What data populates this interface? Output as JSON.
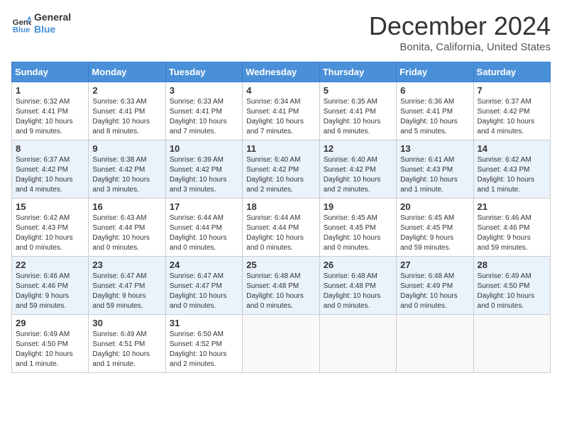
{
  "header": {
    "logo_line1": "General",
    "logo_line2": "Blue",
    "title": "December 2024",
    "subtitle": "Bonita, California, United States"
  },
  "days_of_week": [
    "Sunday",
    "Monday",
    "Tuesday",
    "Wednesday",
    "Thursday",
    "Friday",
    "Saturday"
  ],
  "weeks": [
    [
      {
        "day": "1",
        "info": "Sunrise: 6:32 AM\nSunset: 4:41 PM\nDaylight: 10 hours\nand 9 minutes."
      },
      {
        "day": "2",
        "info": "Sunrise: 6:33 AM\nSunset: 4:41 PM\nDaylight: 10 hours\nand 8 minutes."
      },
      {
        "day": "3",
        "info": "Sunrise: 6:33 AM\nSunset: 4:41 PM\nDaylight: 10 hours\nand 7 minutes."
      },
      {
        "day": "4",
        "info": "Sunrise: 6:34 AM\nSunset: 4:41 PM\nDaylight: 10 hours\nand 7 minutes."
      },
      {
        "day": "5",
        "info": "Sunrise: 6:35 AM\nSunset: 4:41 PM\nDaylight: 10 hours\nand 6 minutes."
      },
      {
        "day": "6",
        "info": "Sunrise: 6:36 AM\nSunset: 4:41 PM\nDaylight: 10 hours\nand 5 minutes."
      },
      {
        "day": "7",
        "info": "Sunrise: 6:37 AM\nSunset: 4:42 PM\nDaylight: 10 hours\nand 4 minutes."
      }
    ],
    [
      {
        "day": "8",
        "info": "Sunrise: 6:37 AM\nSunset: 4:42 PM\nDaylight: 10 hours\nand 4 minutes."
      },
      {
        "day": "9",
        "info": "Sunrise: 6:38 AM\nSunset: 4:42 PM\nDaylight: 10 hours\nand 3 minutes."
      },
      {
        "day": "10",
        "info": "Sunrise: 6:39 AM\nSunset: 4:42 PM\nDaylight: 10 hours\nand 3 minutes."
      },
      {
        "day": "11",
        "info": "Sunrise: 6:40 AM\nSunset: 4:42 PM\nDaylight: 10 hours\nand 2 minutes."
      },
      {
        "day": "12",
        "info": "Sunrise: 6:40 AM\nSunset: 4:42 PM\nDaylight: 10 hours\nand 2 minutes."
      },
      {
        "day": "13",
        "info": "Sunrise: 6:41 AM\nSunset: 4:43 PM\nDaylight: 10 hours\nand 1 minute."
      },
      {
        "day": "14",
        "info": "Sunrise: 6:42 AM\nSunset: 4:43 PM\nDaylight: 10 hours\nand 1 minute."
      }
    ],
    [
      {
        "day": "15",
        "info": "Sunrise: 6:42 AM\nSunset: 4:43 PM\nDaylight: 10 hours\nand 0 minutes."
      },
      {
        "day": "16",
        "info": "Sunrise: 6:43 AM\nSunset: 4:44 PM\nDaylight: 10 hours\nand 0 minutes."
      },
      {
        "day": "17",
        "info": "Sunrise: 6:44 AM\nSunset: 4:44 PM\nDaylight: 10 hours\nand 0 minutes."
      },
      {
        "day": "18",
        "info": "Sunrise: 6:44 AM\nSunset: 4:44 PM\nDaylight: 10 hours\nand 0 minutes."
      },
      {
        "day": "19",
        "info": "Sunrise: 6:45 AM\nSunset: 4:45 PM\nDaylight: 10 hours\nand 0 minutes."
      },
      {
        "day": "20",
        "info": "Sunrise: 6:45 AM\nSunset: 4:45 PM\nDaylight: 9 hours\nand 59 minutes."
      },
      {
        "day": "21",
        "info": "Sunrise: 6:46 AM\nSunset: 4:46 PM\nDaylight: 9 hours\nand 59 minutes."
      }
    ],
    [
      {
        "day": "22",
        "info": "Sunrise: 6:46 AM\nSunset: 4:46 PM\nDaylight: 9 hours\nand 59 minutes."
      },
      {
        "day": "23",
        "info": "Sunrise: 6:47 AM\nSunset: 4:47 PM\nDaylight: 9 hours\nand 59 minutes."
      },
      {
        "day": "24",
        "info": "Sunrise: 6:47 AM\nSunset: 4:47 PM\nDaylight: 10 hours\nand 0 minutes."
      },
      {
        "day": "25",
        "info": "Sunrise: 6:48 AM\nSunset: 4:48 PM\nDaylight: 10 hours\nand 0 minutes."
      },
      {
        "day": "26",
        "info": "Sunrise: 6:48 AM\nSunset: 4:48 PM\nDaylight: 10 hours\nand 0 minutes."
      },
      {
        "day": "27",
        "info": "Sunrise: 6:48 AM\nSunset: 4:49 PM\nDaylight: 10 hours\nand 0 minutes."
      },
      {
        "day": "28",
        "info": "Sunrise: 6:49 AM\nSunset: 4:50 PM\nDaylight: 10 hours\nand 0 minutes."
      }
    ],
    [
      {
        "day": "29",
        "info": "Sunrise: 6:49 AM\nSunset: 4:50 PM\nDaylight: 10 hours\nand 1 minute."
      },
      {
        "day": "30",
        "info": "Sunrise: 6:49 AM\nSunset: 4:51 PM\nDaylight: 10 hours\nand 1 minute."
      },
      {
        "day": "31",
        "info": "Sunrise: 6:50 AM\nSunset: 4:52 PM\nDaylight: 10 hours\nand 2 minutes."
      },
      {
        "day": "",
        "info": ""
      },
      {
        "day": "",
        "info": ""
      },
      {
        "day": "",
        "info": ""
      },
      {
        "day": "",
        "info": ""
      }
    ]
  ]
}
